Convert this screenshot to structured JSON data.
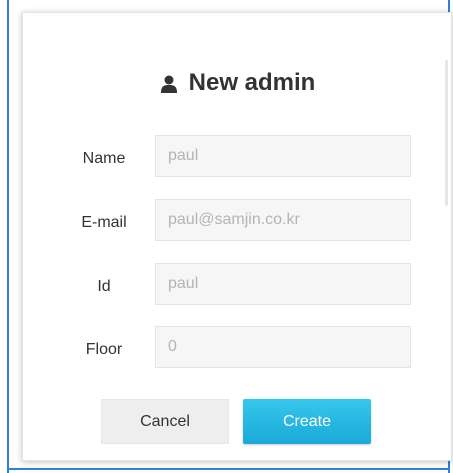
{
  "dialog": {
    "title": "New admin",
    "title_icon": "user-icon"
  },
  "form": {
    "fields": [
      {
        "label": "Name",
        "value": "paul"
      },
      {
        "label": "E-mail",
        "value": "paul@samjin.co.kr"
      },
      {
        "label": "Id",
        "value": "paul"
      },
      {
        "label": "Floor",
        "value": "0"
      }
    ]
  },
  "buttons": {
    "cancel_label": "Cancel",
    "create_label": "Create"
  },
  "colors": {
    "accent": "#29b6e4",
    "frame": "#2f80d6",
    "field_bg": "#f6f6f6"
  }
}
